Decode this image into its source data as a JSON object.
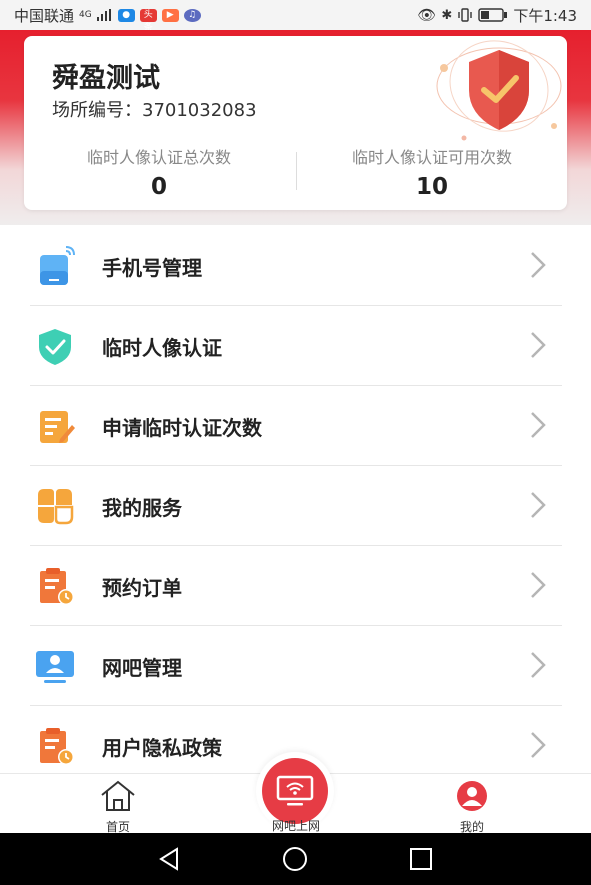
{
  "status_bar": {
    "carrier": "中国联通",
    "network": "4G",
    "app_badges": [
      "头条"
    ],
    "time": "下午1:43"
  },
  "venue": {
    "name": "舜盈测试",
    "code_label": "场所编号：",
    "code_value": "3701032083",
    "stats": [
      {
        "label": "临时人像认证总次数",
        "value": "0"
      },
      {
        "label": "临时人像认证可用次数",
        "value": "10"
      }
    ]
  },
  "menu": [
    {
      "label": "手机号管理",
      "icon": "phone-icon"
    },
    {
      "label": "临时人像认证",
      "icon": "shield-check-icon"
    },
    {
      "label": "申请临时认证次数",
      "icon": "edit-document-icon"
    },
    {
      "label": "我的服务",
      "icon": "service-grid-icon"
    },
    {
      "label": "预约订单",
      "icon": "clipboard-clock-icon"
    },
    {
      "label": "网吧管理",
      "icon": "monitor-user-icon"
    },
    {
      "label": "用户隐私政策",
      "icon": "clipboard-clock-icon"
    }
  ],
  "tabs": {
    "home": "首页",
    "center": "网吧上网",
    "mine": "我的"
  },
  "colors": {
    "brand_red": "#e63c45",
    "header_red": "#e6202e",
    "icon_orange": "#f08a3a",
    "icon_blue": "#4aa3f0",
    "icon_teal": "#3ecfb4"
  }
}
